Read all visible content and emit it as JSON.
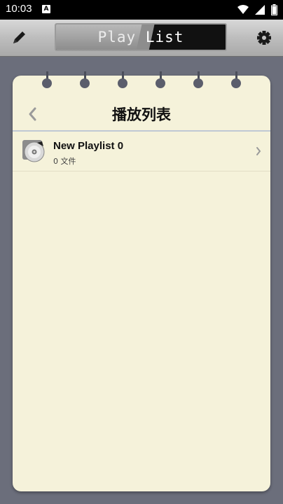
{
  "status_bar": {
    "time": "10:03",
    "app_badge": "A"
  },
  "toolbar": {
    "title_part1": "Play",
    "title_part2": "List",
    "edit_icon": "pencil-icon",
    "settings_icon": "gear-icon"
  },
  "notebook": {
    "title": "播放列表",
    "back_icon": "chevron-left-icon"
  },
  "playlists": [
    {
      "name": "New Playlist 0",
      "count": "0",
      "unit": "文件",
      "icon": "cd-disc-icon"
    }
  ],
  "colors": {
    "paper": "#f5f2da",
    "background": "#6b6e7b"
  }
}
